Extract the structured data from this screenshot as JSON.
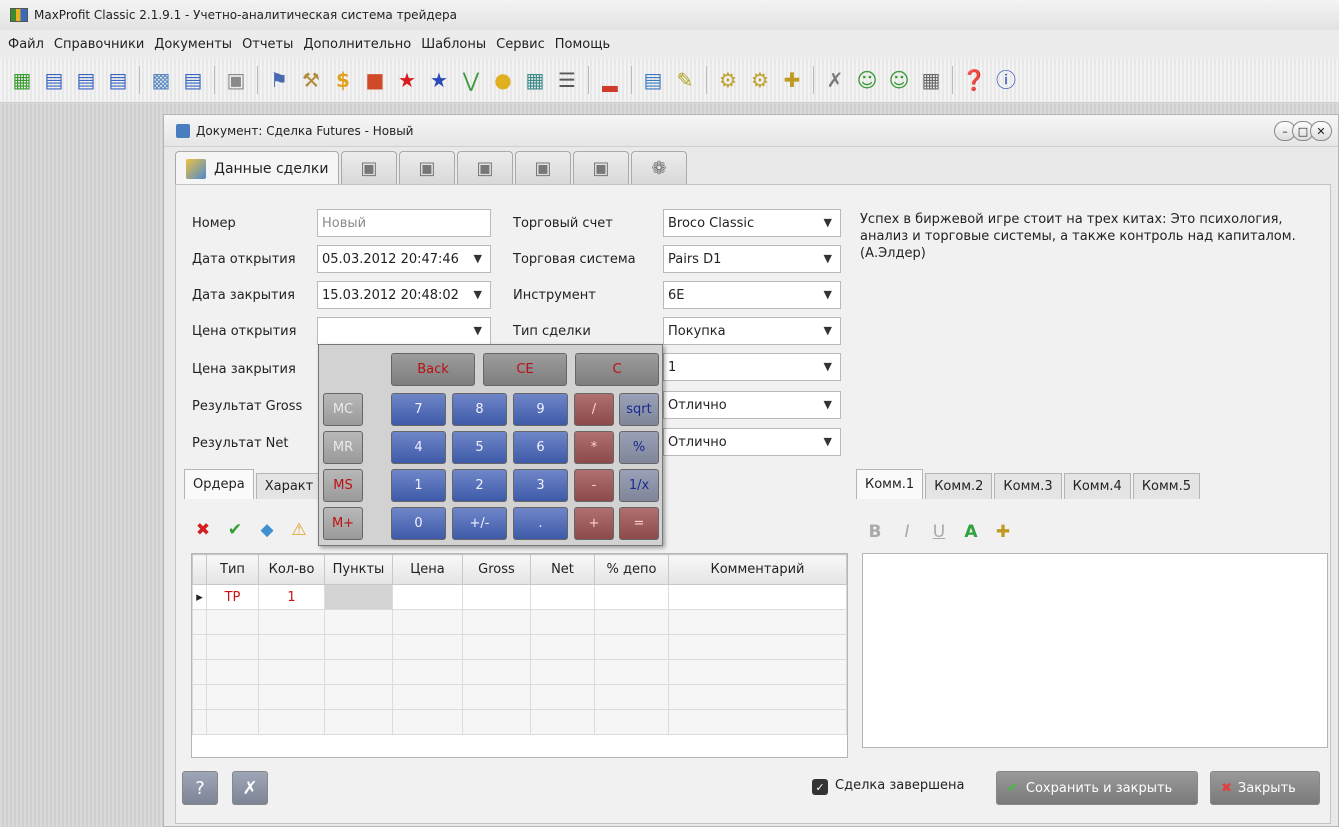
{
  "app": {
    "title": "MaxProfit Classic 2.1.9.1 - Учетно-аналитическая система трейдера",
    "menu": [
      "Файл",
      "Справочники",
      "Документы",
      "Отчеты",
      "Дополнительно",
      "Шаблоны",
      "Сервис",
      "Помощь"
    ]
  },
  "toolbar": {
    "groups": [
      [
        "document-green-icon",
        "document-blue-icon",
        "document-blue-icon",
        "document-blue-icon"
      ],
      [
        "document-grid-icon",
        "document-arrow-icon"
      ],
      [
        "calculator-doc-icon"
      ],
      [
        "bank-icon",
        "tools-icon",
        "dollar-icon",
        "blocks-icon",
        "star-red-icon",
        "star-blue-icon",
        "coins-icon",
        "speech-icon",
        "chart-doc-icon",
        "list-icon"
      ],
      [
        "bar-chart-icon"
      ],
      [
        "report-icon",
        "edit-doc-icon"
      ],
      [
        "gears-icon",
        "gears2-icon",
        "plugin-icon"
      ],
      [
        "wrench-icon",
        "users-icon",
        "users2-icon",
        "calculator-icon"
      ],
      [
        "help-icon",
        "info-icon"
      ]
    ]
  },
  "document": {
    "title": "Документ: Сделка Futures - Новый",
    "main_tab_label": "Данные сделки",
    "main_tab_count": 6,
    "quote": "Успех в биржевой игре стоит на трех китах: Это психология, анализ и торговые системы, а также контроль над капиталом. (А.Элдер)"
  },
  "form": {
    "number_label": "Номер",
    "number_placeholder": "Новый",
    "open_date_label": "Дата открытия",
    "open_date_value": "05.03.2012 20:47:46",
    "close_date_label": "Дата закрытия",
    "close_date_value": "15.03.2012 20:48:02",
    "open_price_label": "Цена открытия",
    "open_price_value": "",
    "close_price_label": "Цена закрытия",
    "gross_label": "Результат Gross",
    "net_label": "Результат Net",
    "account_label": "Торговый счет",
    "account_value": "Broco Classic",
    "system_label": "Торговая система",
    "system_value": "Pairs D1",
    "instrument_label": "Инструмент",
    "instrument_value": "6E",
    "deal_type_label": "Тип сделки",
    "deal_type_value": "Покупка",
    "extra1_value": "1",
    "extra2_value": "Отлично",
    "extra3_value": "Отлично"
  },
  "calculator": {
    "top_row": [
      "Back",
      "CE",
      "C"
    ],
    "memory": [
      "MC",
      "MR",
      "MS",
      "M+"
    ],
    "rows": [
      [
        "7",
        "8",
        "9",
        "/",
        "sqrt"
      ],
      [
        "4",
        "5",
        "6",
        "*",
        "%"
      ],
      [
        "1",
        "2",
        "3",
        "-",
        "1/x"
      ],
      [
        "0",
        "+/-",
        ".",
        "+",
        "="
      ]
    ]
  },
  "orders": {
    "tabs": [
      "Ордера",
      "Характ"
    ],
    "columns": [
      "Тип",
      "Кол-во",
      "Пункты",
      "Цена",
      "Gross",
      "Net",
      "% депо",
      "Комментарий"
    ],
    "rows": [
      [
        "TP",
        "1",
        "",
        "",
        "",
        "",
        "",
        ""
      ]
    ],
    "empty_rows": 6
  },
  "comments": {
    "tabs": [
      "Комм.1",
      "Комм.2",
      "Комм.3",
      "Комм.4",
      "Комм.5"
    ]
  },
  "footer": {
    "completed_label": "Сделка завершена",
    "completed_checked": true,
    "save_close_label": "Сохранить и закрыть",
    "close_label": "Закрыть"
  },
  "colors": {
    "accent_red": "#d01010",
    "calc_blue": "#3e5aa8"
  }
}
